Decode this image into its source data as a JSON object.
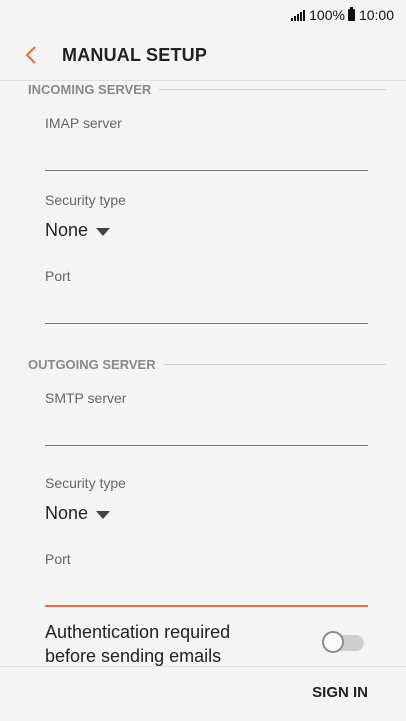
{
  "status_bar": {
    "battery_percent": "100%",
    "time": "10:00",
    "icons": [
      "signal-icon",
      "battery-icon"
    ]
  },
  "header": {
    "title": "MANUAL SETUP",
    "back_icon": "chevron-left-icon"
  },
  "incoming": {
    "section_title": "INCOMING SERVER",
    "server_label": "IMAP server",
    "server_value": "",
    "security_label": "Security type",
    "security_value": "None",
    "port_label": "Port",
    "port_value": ""
  },
  "outgoing": {
    "section_title": "OUTGOING SERVER",
    "server_label": "SMTP server",
    "server_value": "",
    "security_label": "Security type",
    "security_value": "None",
    "port_label": "Port",
    "port_value": "",
    "port_focused": true
  },
  "auth": {
    "label": "Authentication required before sending emails",
    "enabled": false
  },
  "footer": {
    "sign_in_label": "SIGN IN"
  },
  "colors": {
    "accent": "#ef6c3e",
    "background": "#f4f4f4",
    "section_header": "#8a8a8a"
  }
}
